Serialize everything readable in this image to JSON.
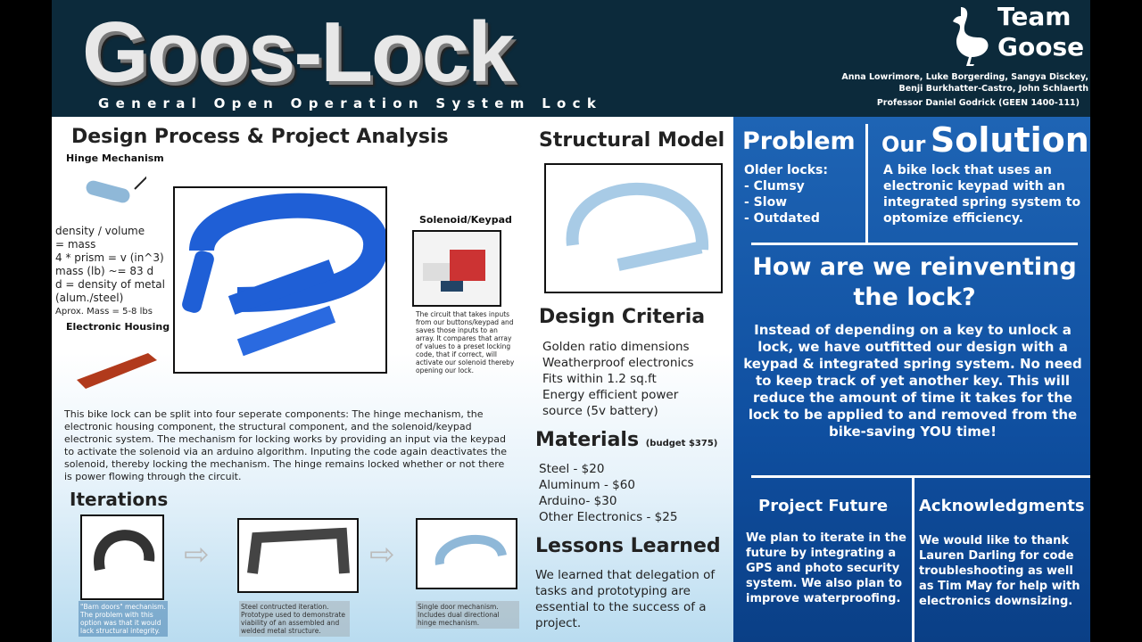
{
  "header": {
    "logo": "Goos-Lock",
    "subtitle": "General Open Operation System Lock",
    "team_line1": "Team",
    "team_line2": "Goose",
    "members_line1": "Anna Lowrimore, Luke Borgerding, Sangya Disckey,",
    "members_line2": "Benji Burkhatter-Castro, John Schlaerth",
    "professor": "Professor Daniel Godrick (GEEN 1400-111)"
  },
  "design": {
    "title": "Design Process & Project Analysis",
    "hinge_label": "Hinge Mechanism",
    "housing_label": "Electronic Housing",
    "solenoid_label": "Solenoid/Keypad",
    "calc": [
      "density / volume",
      "= mass",
      "4 * prism = v (in^3)",
      "mass (lb) ~= 83 d",
      "d = density of metal",
      "(alum./steel)",
      "Aprox. Mass = 5-8 lbs"
    ],
    "solenoid_caption": "The circuit that takes inputs from our buttons/keypad and saves those inputs to an array. It compares that array of values to a preset locking code, that if correct, will activate our solenoid thereby opening our lock.",
    "description": "This bike lock can be split into four seperate components: The hinge mechanism, the electronic housing component, the structural component, and the solenoid/keypad electronic system. The mechanism for locking works by providing an input via the keypad to activate the solenoid via an arduino algorithm. Inputing the code again deactivates the solenoid, thereby locking the mechanism. The hinge remains locked whether or not there is power flowing through the circuit."
  },
  "iterations": {
    "title": "Iterations",
    "captions": [
      "\"Barn doors\" mechanism. The problem with this option was that it would lack structural integrity.",
      "Steel contructed iteration. Prototype used to demonstrate viability of an assembled and welded metal structure.",
      "Single door mechanism. Includes dual directional hinge mechanism."
    ]
  },
  "structural": {
    "title": "Structural Model"
  },
  "criteria": {
    "title": "Design Criteria",
    "items": [
      "Golden ratio dimensions",
      "Weatherproof electronics",
      "Fits within 1.2 sq.ft",
      "Energy efficient power",
      "source (5v battery)"
    ]
  },
  "materials": {
    "title": "Materials",
    "budget": "(budget $375)",
    "items": [
      "Steel - $20",
      "Aluminum - $60",
      "Arduino- $30",
      "Other Electronics - $25"
    ]
  },
  "lessons": {
    "title": "Lessons Learned",
    "text": "We learned that delegation of tasks and prototyping are essential to the success of a project."
  },
  "problem": {
    "title": "Problem",
    "lead": "Older locks:",
    "items": [
      "- Clumsy",
      "- Slow",
      "- Outdated"
    ]
  },
  "solution": {
    "title_small": "Our",
    "title_big": "Solution",
    "text": "A bike lock that uses an electronic keypad with an integrated spring system to optomize efficiency."
  },
  "reinvent": {
    "title": "How are we reinventing the lock?",
    "text": "Instead of depending on a key to unlock a lock, we have outfitted our design with a keypad & integrated spring system. No need to keep track of yet another key. This will reduce the amount of time it takes for the lock to be applied to and removed from the bike-saving YOU time!"
  },
  "future": {
    "title": "Project Future",
    "text": "We plan to iterate in the future by integrating a GPS and photo security system. We also plan to improve waterproofing."
  },
  "ack": {
    "title": "Acknowledgments",
    "text": "We would like to thank Lauren Darling for code troubleshooting as well as Tim May for help with electronics downsizing."
  },
  "colors": {
    "header": "#0c2a3b",
    "panel": "#1a5fae",
    "lock_blue": "#1f5fd6"
  }
}
